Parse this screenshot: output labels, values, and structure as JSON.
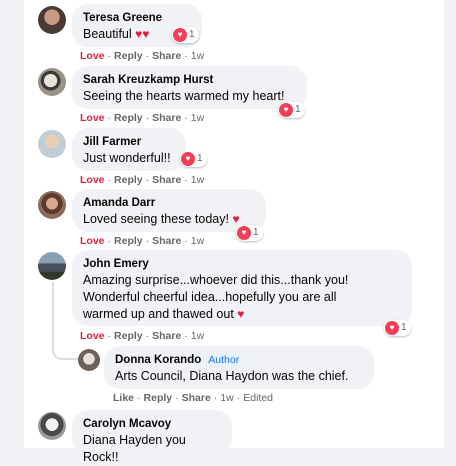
{
  "comments": [
    {
      "name": "Teresa Greene",
      "text": "Beautiful",
      "emoji": "♥♥",
      "love_label": "Love",
      "reply_label": "Reply",
      "share_label": "Share",
      "time": "1w",
      "reaction_count": "1"
    },
    {
      "name": "Sarah Kreuzkamp Hurst",
      "text": "Seeing the hearts warmed my heart!",
      "love_label": "Love",
      "reply_label": "Reply",
      "share_label": "Share",
      "time": "1w",
      "reaction_count": "1"
    },
    {
      "name": "Jill Farmer",
      "text": "Just wonderful!!",
      "love_label": "Love",
      "reply_label": "Reply",
      "share_label": "Share",
      "time": "1w",
      "reaction_count": "1"
    },
    {
      "name": "Amanda Darr",
      "text": "Loved seeing these today!",
      "emoji": "♥",
      "love_label": "Love",
      "reply_label": "Reply",
      "share_label": "Share",
      "time": "1w",
      "reaction_count": "1"
    },
    {
      "name": "John Emery",
      "text_lines": [
        "Amazing surprise...whoever did this...thank you!",
        "Wonderful cheerful idea...hopefully you are all",
        "warmed up and thawed out"
      ],
      "emoji": "♥",
      "love_label": "Love",
      "reply_label": "Reply",
      "share_label": "Share",
      "time": "1w",
      "reaction_count": "1"
    },
    {
      "name": "Donna Korando",
      "badge": "Author",
      "text": "Arts Council, Diana Haydon was the chief.",
      "like_label": "Like",
      "reply_label": "Reply",
      "share_label": "Share",
      "time": "1w",
      "edited": "Edited"
    },
    {
      "name": "Carolyn Mcavoy",
      "text": "Diana Hayden you Rock!!"
    }
  ],
  "colors": {
    "love": "#e41e3f",
    "badge": "#1877f2",
    "bubble": "#f0f2f5"
  }
}
